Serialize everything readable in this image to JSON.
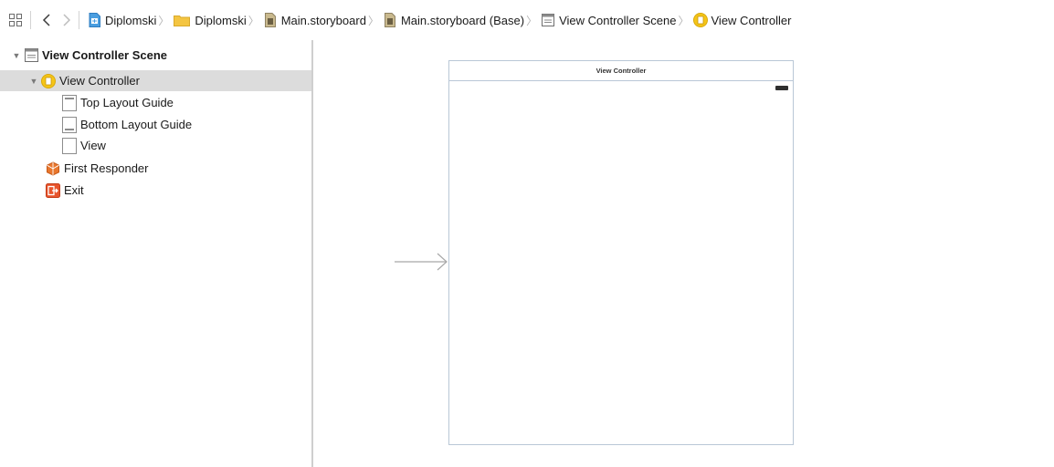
{
  "jumpbar": {
    "icons": {
      "related": "related-items-grid-icon",
      "back": "chevron-left-icon",
      "forward": "chevron-right-icon"
    },
    "crumbs": [
      {
        "label": "Diplomski",
        "icon": "project-file-icon"
      },
      {
        "label": "Diplomski",
        "icon": "folder-icon"
      },
      {
        "label": "Main.storyboard",
        "icon": "storyboard-file-icon"
      },
      {
        "label": "Main.storyboard (Base)",
        "icon": "storyboard-file-icon"
      },
      {
        "label": "View Controller Scene",
        "icon": "scene-icon"
      },
      {
        "label": "View Controller",
        "icon": "view-controller-icon"
      }
    ]
  },
  "outline": {
    "scene": {
      "label": "View Controller Scene",
      "expanded": true
    },
    "view_controller": {
      "label": "View Controller",
      "expanded": true,
      "selected": true
    },
    "children": [
      {
        "label": "Top Layout Guide",
        "icon": "top-layout-guide-icon"
      },
      {
        "label": "Bottom Layout Guide",
        "icon": "bottom-layout-guide-icon"
      },
      {
        "label": "View",
        "icon": "view-icon"
      }
    ],
    "first_responder": {
      "label": "First Responder",
      "icon": "first-responder-icon"
    },
    "exit": {
      "label": "Exit",
      "icon": "exit-icon"
    }
  },
  "canvas": {
    "scene_title": "View Controller",
    "entry_point_icon": "initial-arrow-icon",
    "battery_icon": "battery-icon"
  },
  "colors": {
    "selection": "#dcdcdc",
    "vc_icon": "#f5c518",
    "folder": "#f4c542",
    "exit": "#e8542c",
    "first_responder": "#e8772e",
    "scene_border": "#b9c7d6"
  }
}
